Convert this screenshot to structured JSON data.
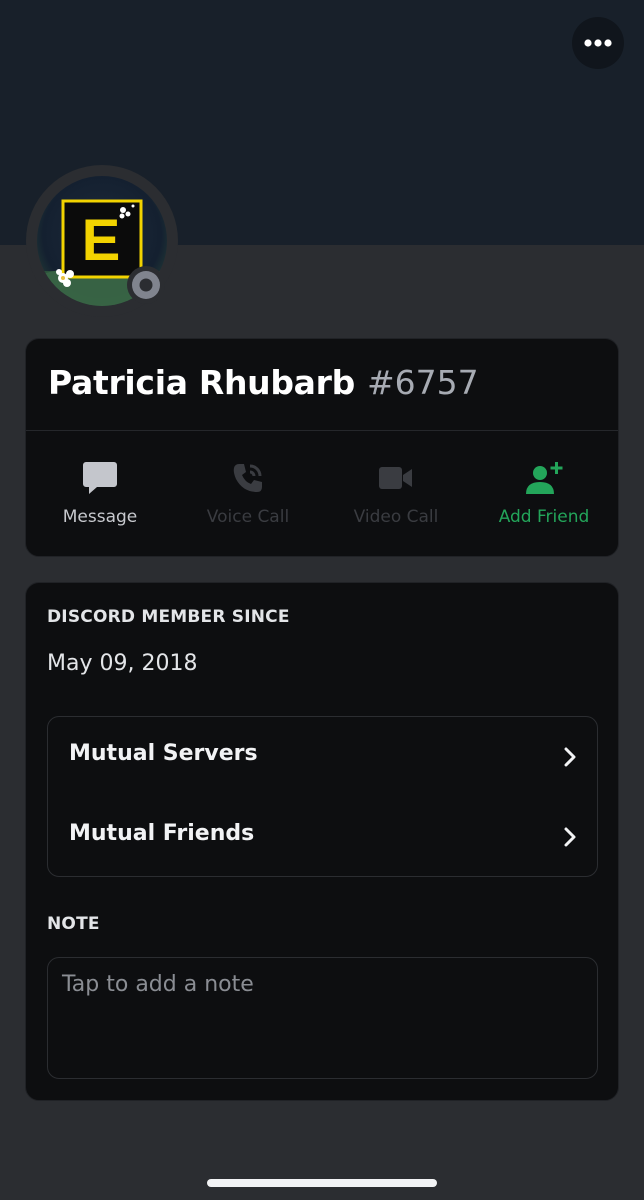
{
  "profile": {
    "display_name": "Patricia Rhubarb",
    "discriminator": "#6757",
    "avatar_letter": "E",
    "status": "offline"
  },
  "header": {
    "more_icon": "ellipsis-icon"
  },
  "actions": [
    {
      "label": "Message",
      "icon": "message-icon",
      "state": "enabled"
    },
    {
      "label": "Voice Call",
      "icon": "phone-icon",
      "state": "disabled"
    },
    {
      "label": "Video Call",
      "icon": "video-icon",
      "state": "disabled"
    },
    {
      "label": "Add Friend",
      "icon": "add-friend-icon",
      "state": "enabled"
    }
  ],
  "member_since": {
    "title": "DISCORD MEMBER SINCE",
    "date": "May 09, 2018"
  },
  "mutuals": [
    {
      "label": "Mutual Servers"
    },
    {
      "label": "Mutual Friends"
    }
  ],
  "note": {
    "title": "NOTE",
    "placeholder": "Tap to add a note",
    "value": ""
  },
  "colors": {
    "background": "#2b2d31",
    "banner": "#18202a",
    "card": "#0d0e10",
    "green_accent": "#23a55a",
    "avatar_badge": "#f2d300"
  }
}
